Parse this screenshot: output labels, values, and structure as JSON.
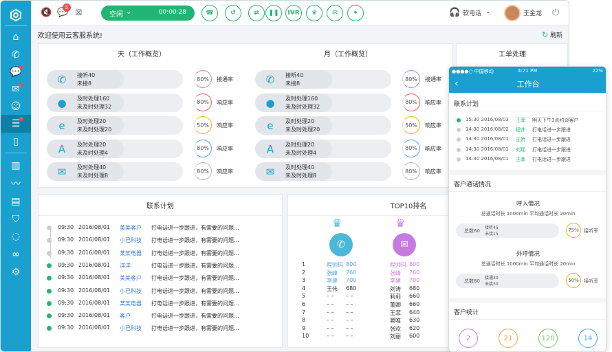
{
  "top": {
    "status": "空闲",
    "timer": "00:00:28",
    "badge": "5",
    "ivr": "IVR",
    "phone_mode": "软电话",
    "user": "王金龙"
  },
  "welcome": "欢迎使用云客服系统!",
  "refresh": "刷新",
  "overview": {
    "day_title": "天（工作概览）",
    "month_title": "月（工作概览）",
    "ticket_title": "工单处理",
    "rows": [
      {
        "l1": "接听40",
        "l2": "未接8",
        "pct": "80%",
        "label": "接通率",
        "color": "#c77be0",
        "icon": "✆"
      },
      {
        "l1": "及时处理160",
        "l2": "未及时处理32",
        "pct": "80%",
        "label": "响应率",
        "color": "#f05a5a",
        "icon": "●"
      },
      {
        "l1": "及时处理20",
        "l2": "未及时处理20",
        "pct": "50%",
        "label": "响应率",
        "color": "#f5b400",
        "icon": "e"
      },
      {
        "l1": "及时处理20",
        "l2": "未及时处理4",
        "pct": "80%",
        "label": "响应率",
        "color": "#4aa8e6",
        "icon": "A"
      },
      {
        "l1": "及时处理40",
        "l2": "未及时处理8",
        "pct": "80%",
        "label": "响应率",
        "color": "#b0b7bf",
        "icon": "✉"
      }
    ]
  },
  "plan": {
    "title": "联系计划",
    "rows": [
      {
        "time": "09:30",
        "date": "2016/08/01",
        "name": "美美客户",
        "text": "打电话进一步跟进，有需要的问题..."
      },
      {
        "time": "09:30",
        "date": "2016/08/01",
        "name": "小已科技",
        "text": "打电话进一步跟进，有需要的问题..."
      },
      {
        "time": "09:30",
        "date": "2016/08/01",
        "name": "某某电器",
        "text": "打电话进一步跟进，有需要的问题..."
      },
      {
        "time": "09:30",
        "date": "2016/08/01",
        "name": "洋洋",
        "text": "打电话进一步跟进，有需要的问题..."
      },
      {
        "time": "09:30",
        "date": "2016/08/01",
        "name": "美美客户",
        "text": "打电话进一步跟进，有需要的问题..."
      },
      {
        "time": "09:30",
        "date": "2016/08/01",
        "name": "小已科技",
        "text": "打电话进一步跟进，有需要的问题..."
      },
      {
        "time": "09:30",
        "date": "2016/08/01",
        "name": "某某电器",
        "text": "打电话进一步跟进，有需要的问题..."
      },
      {
        "time": "09:30",
        "date": "2016/08/01",
        "name": "客户",
        "text": "打电话进一步跟进，有需要的问题..."
      },
      {
        "time": "09:30",
        "date": "2016/08/01",
        "name": "小已科技",
        "text": "打电话进一步跟进，有需要的问题..."
      }
    ]
  },
  "top10": {
    "title": "TOP10排名",
    "rows": [
      {
        "n": "1",
        "a": "程帅玛",
        "av": "800",
        "b": "程帅玛",
        "bv": "800"
      },
      {
        "n": "2",
        "a": "张峰",
        "av": "760",
        "b": "张峰",
        "bv": "760"
      },
      {
        "n": "3",
        "a": "李建",
        "av": "700",
        "b": "李建",
        "bv": "700"
      },
      {
        "n": "4",
        "a": "王伟",
        "av": "680",
        "b": "刘涛",
        "bv": "680"
      },
      {
        "n": "5",
        "a": "– –",
        "av": "– –",
        "b": "莉莉",
        "bv": "660"
      },
      {
        "n": "6",
        "a": "– –",
        "av": "– –",
        "b": "董卿",
        "bv": "660"
      },
      {
        "n": "7",
        "a": "– –",
        "av": "– –",
        "b": "王菲",
        "bv": "640"
      },
      {
        "n": "8",
        "a": "– –",
        "av": "– –",
        "b": "窦唯",
        "bv": "630"
      },
      {
        "n": "9",
        "a": "– –",
        "av": "– –",
        "b": "张欢",
        "bv": "620"
      },
      {
        "n": "10",
        "a": "– –",
        "av": "– –",
        "b": "刘丽",
        "bv": "600"
      }
    ]
  },
  "mobile": {
    "carrier": "●●●●○ 中国移动",
    "time": "4:21 PM",
    "battery": "22%",
    "title": "工作台",
    "plan_title": "联系计划",
    "plan": [
      {
        "t": "15:30  2016/08/03",
        "n": "王菲",
        "x": "明天下午3点约谈客户"
      },
      {
        "t": "14:30  2016/08/02",
        "n": "程帅",
        "x": "打电话进一步跟进"
      },
      {
        "t": "14:30  2016/08/01",
        "n": "王娇",
        "x": "打电话进一步跟进"
      },
      {
        "t": "14:30  2016/08/01",
        "n": "刘瑶",
        "x": "打电话进一步跟进"
      },
      {
        "t": "14:30  2016/08/01",
        "n": "王菲",
        "x": "打电话进一步跟进"
      }
    ],
    "call_title": "客户通话情况",
    "in_title": "呼入情况",
    "in_sub": "总通话时长 1000min    平均通话时长 20min",
    "in_total": "总数60",
    "in_l1": "接听45",
    "in_l2": "未接15",
    "in_pct": "75%",
    "in_lbl": "接听率",
    "out_title": "外呼情况",
    "out_sub": "总通话时长 1000min    平均通话时长 20min",
    "out_total": "总数60",
    "out_l1": "接通30",
    "out_l2": "未接30",
    "out_pct": "50%",
    "out_lbl": "接听率",
    "stats_title": "客户统计",
    "stats": [
      "2",
      "21",
      "120",
      "14"
    ]
  }
}
